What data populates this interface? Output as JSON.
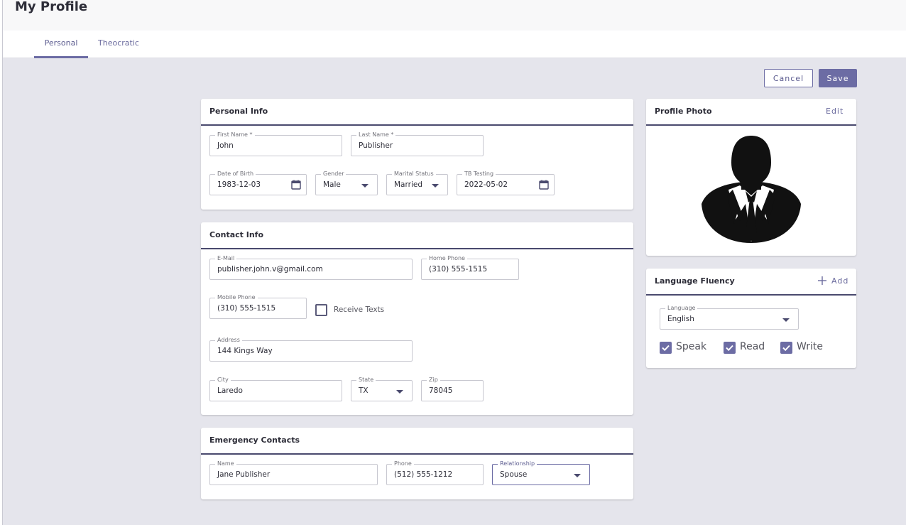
{
  "header": {
    "title": "My Profile"
  },
  "tabs": [
    {
      "label": "Personal",
      "active": true
    },
    {
      "label": "Theocratic",
      "active": false
    }
  ],
  "actions": {
    "cancel": "Cancel",
    "save": "Save"
  },
  "personal_info": {
    "title": "Personal Info",
    "first_name": {
      "label": "First Name *",
      "value": "John"
    },
    "last_name": {
      "label": "Last Name *",
      "value": "Publisher"
    },
    "dob": {
      "label": "Date of Birth",
      "value": "1983-12-03"
    },
    "gender": {
      "label": "Gender",
      "value": "Male"
    },
    "marital": {
      "label": "Marital Status",
      "value": "Married"
    },
    "tb": {
      "label": "TB Testing",
      "value": "2022-05-02"
    }
  },
  "contact_info": {
    "title": "Contact Info",
    "email": {
      "label": "E-Mail",
      "value": "publisher.john.v@gmail.com"
    },
    "home_phone": {
      "label": "Home Phone",
      "value": "(310) 555-1515"
    },
    "mobile_phone": {
      "label": "Mobile Phone",
      "value": "(310) 555-1515"
    },
    "receive_texts": {
      "label": "Receive Texts",
      "checked": false
    },
    "address": {
      "label": "Address",
      "value": "144 Kings Way"
    },
    "city": {
      "label": "City",
      "value": "Laredo"
    },
    "state": {
      "label": "State",
      "value": "TX"
    },
    "zip": {
      "label": "Zip",
      "value": "78045"
    }
  },
  "emergency": {
    "title": "Emergency Contacts",
    "name": {
      "label": "Name",
      "value": "Jane Publisher"
    },
    "phone": {
      "label": "Phone",
      "value": "(512) 555-1212"
    },
    "relationship": {
      "label": "Relationship",
      "value": "Spouse"
    }
  },
  "photo": {
    "title": "Profile Photo",
    "edit": "Edit"
  },
  "language": {
    "title": "Language Fluency",
    "add": "Add",
    "field": {
      "label": "Language",
      "value": "English"
    },
    "speak": "Speak",
    "read": "Read",
    "write": "Write"
  },
  "colors": {
    "accent": "#6c6ca4",
    "background": "#e5e5ec",
    "header_rule": "#4a4a6e"
  }
}
